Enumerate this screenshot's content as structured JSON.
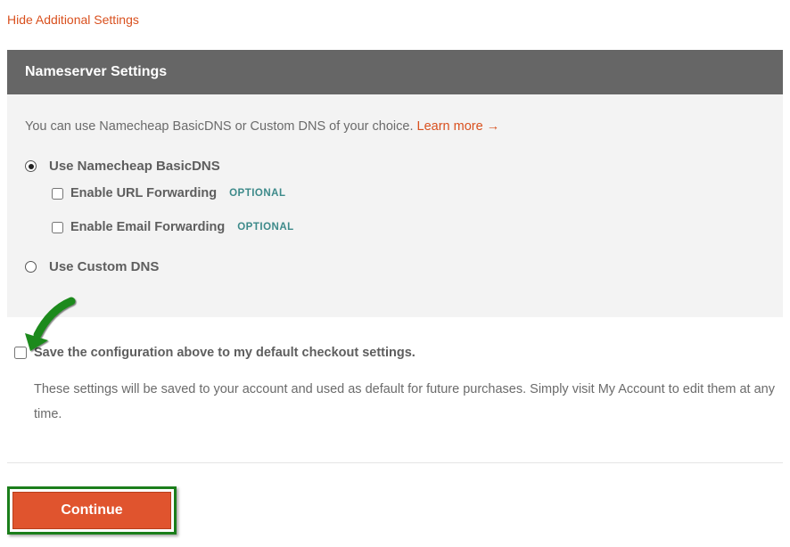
{
  "hide_settings_link": "Hide Additional Settings",
  "panel": {
    "title": "Nameserver Settings",
    "intro_text": "You can use Namecheap BasicDNS or Custom DNS of your choice. ",
    "learn_more": "Learn more →",
    "options": {
      "basic_dns_label": "Use Namecheap BasicDNS",
      "custom_dns_label": "Use Custom DNS",
      "url_forwarding_label": "Enable URL Forwarding",
      "email_forwarding_label": "Enable Email Forwarding",
      "optional_badge": "OPTIONAL"
    }
  },
  "save": {
    "label": "Save the configuration above to my default checkout settings.",
    "description": "These settings will be saved to your account and used as default for future purchases. Simply visit My Account to edit them at any time."
  },
  "continue_button": "Continue"
}
